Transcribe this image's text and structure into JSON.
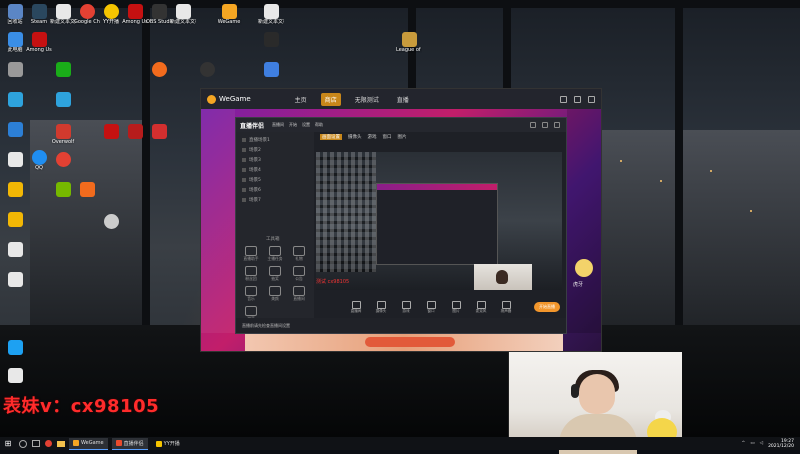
{
  "desktop": {
    "icons": [
      {
        "label": "回收站",
        "color": "#5b86c5"
      },
      {
        "label": "Steam",
        "color": "#2a475e"
      },
      {
        "label": "新建文本文档",
        "color": "#e8e8e8"
      },
      {
        "label": "Google Chrome",
        "color": "#e34133"
      },
      {
        "label": "YY开播",
        "color": "#f5c400"
      },
      {
        "label": "Among Us",
        "color": "#c51111"
      },
      {
        "label": "OBS Studio",
        "color": "#333333"
      },
      {
        "label": "新建文本文档",
        "color": "#e8e8e8"
      },
      {
        "label": "WeGame",
        "color": "#f5a623"
      },
      {
        "label": "新建文本文档",
        "color": "#e8e8e8"
      },
      {
        "label": "此电脑",
        "color": "#3a8ee6"
      },
      {
        "label": "Among Us",
        "color": "#c51111"
      },
      {
        "label": "Overwolf",
        "color": "#d13a2e"
      },
      {
        "label": "QQ",
        "color": "#1f8ef1"
      },
      {
        "label": "League of Legends",
        "color": "#c89b3c"
      }
    ],
    "watermark": "表妹v：cx98105"
  },
  "wegame": {
    "brand": "WeGame",
    "nav": [
      {
        "label": "主页",
        "active": false
      },
      {
        "label": "商店",
        "active": true
      },
      {
        "label": "无限测试",
        "active": false
      },
      {
        "label": "直播",
        "active": false
      }
    ],
    "right_badge": "虎牙"
  },
  "streamer": {
    "app_name": "直播伴侣",
    "tags": [
      "直播间",
      "开始",
      "设置",
      "帮助"
    ],
    "top_tabs": [
      {
        "label": "画面设置",
        "active": true
      },
      {
        "label": "摄像头",
        "active": false
      },
      {
        "label": "游戏",
        "active": false
      },
      {
        "label": "窗口",
        "active": false
      },
      {
        "label": "图片",
        "active": false
      }
    ],
    "scenes": [
      "直播场景1",
      "场景2",
      "场景3",
      "场景4",
      "场景5",
      "场景6",
      "场景7"
    ],
    "tools_title": "工具箱",
    "tools": [
      "直播助手",
      "主播任务",
      "礼物",
      "粉丝团",
      "抽奖",
      "公告",
      "音乐",
      "美颜",
      "直播间",
      "弹幕"
    ],
    "red_text": "测试  cx98105",
    "bottom_buttons": [
      "直播间",
      "摄像头",
      "游戏",
      "窗口",
      "图片",
      "麦克风",
      "扬声器"
    ],
    "start_button": "开始直播",
    "footer": "直播前请先检查直播间设置"
  },
  "taskbar": {
    "start_glyph": "⊞",
    "tasks": [
      {
        "label": "WeGame",
        "color": "#f5a623",
        "active": true
      },
      {
        "label": "直播伴侣",
        "color": "#e94a2c",
        "active": true
      },
      {
        "label": "YY开播",
        "color": "#f5c400",
        "active": false
      }
    ],
    "time": "19:27",
    "date": "2021/12/20"
  }
}
